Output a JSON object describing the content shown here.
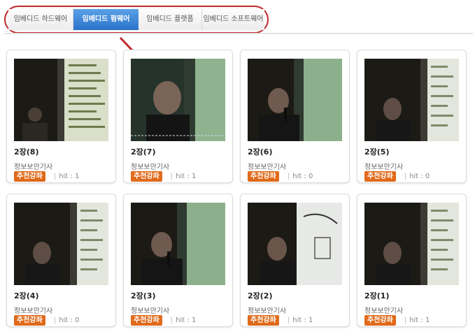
{
  "tabs": [
    {
      "label": "임베디드 하드웨어",
      "active": false
    },
    {
      "label": "임베디드 펌웨어",
      "active": true
    },
    {
      "label": "임베디드 플랫폼",
      "active": false
    },
    {
      "label": "임베디드 소프트웨어",
      "active": false
    }
  ],
  "colors": {
    "tab_outline": "#c0282e",
    "tab_active": "#2a73c9",
    "badge": "#e06a1a",
    "arrow": "#c0282e"
  },
  "cards": [
    {
      "title": "2장(8)",
      "subtitle": "정보보안기사",
      "badge": "추천강좌",
      "hit": "hit : 1",
      "scene": "slides"
    },
    {
      "title": "2장(7)",
      "subtitle": "정보보안기사",
      "badge": "추천강좌",
      "hit": "hit : 1",
      "scene": "closeup"
    },
    {
      "title": "2장(6)",
      "subtitle": "정보보안기사",
      "badge": "추천강좌",
      "hit": "hit : 0",
      "scene": "mic"
    },
    {
      "title": "2장(5)",
      "subtitle": "정보보안기사",
      "badge": "추천강좌",
      "hit": "hit : 0",
      "scene": "slides-right"
    },
    {
      "title": "2장(4)",
      "subtitle": "정보보안기사",
      "badge": "추천강좌",
      "hit": "hit : 0",
      "scene": "slides-right"
    },
    {
      "title": "2장(3)",
      "subtitle": "정보보안기사",
      "badge": "추천강좌",
      "hit": "hit : 1",
      "scene": "mic"
    },
    {
      "title": "2장(2)",
      "subtitle": "정보보안기사",
      "badge": "추천강좌",
      "hit": "hit : 1",
      "scene": "board"
    },
    {
      "title": "2장(1)",
      "subtitle": "정보보안기사",
      "badge": "추천강좌",
      "hit": "hit : 1",
      "scene": "slides-right"
    }
  ]
}
